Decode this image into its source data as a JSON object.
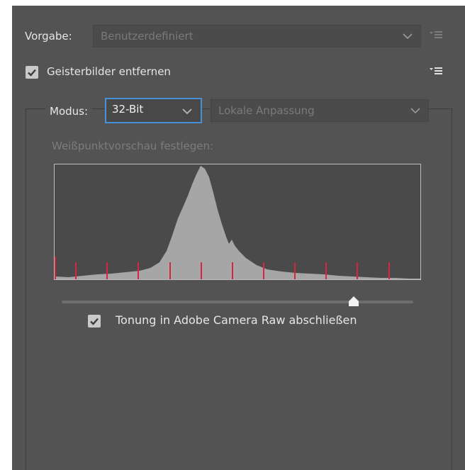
{
  "preset": {
    "label": "Vorgabe:",
    "value": "Benutzerdefiniert"
  },
  "remove_ghosts": {
    "label": "Geisterbilder entfernen",
    "checked": true
  },
  "mode": {
    "label": "Modus:",
    "value": "32-Bit",
    "method_value": "Lokale Anpassung"
  },
  "white_point": {
    "label": "Weißpunktvorschau festlegen:"
  },
  "histogram": {
    "marker_color": "#d7263d",
    "fill_color": "#a6a6a6",
    "slider_value": 0.83
  },
  "tone_acr": {
    "label": "Tonung in Adobe Camera Raw abschließen",
    "checked": true
  },
  "colors": {
    "panel": "#535353",
    "focus": "#4a90d9"
  }
}
